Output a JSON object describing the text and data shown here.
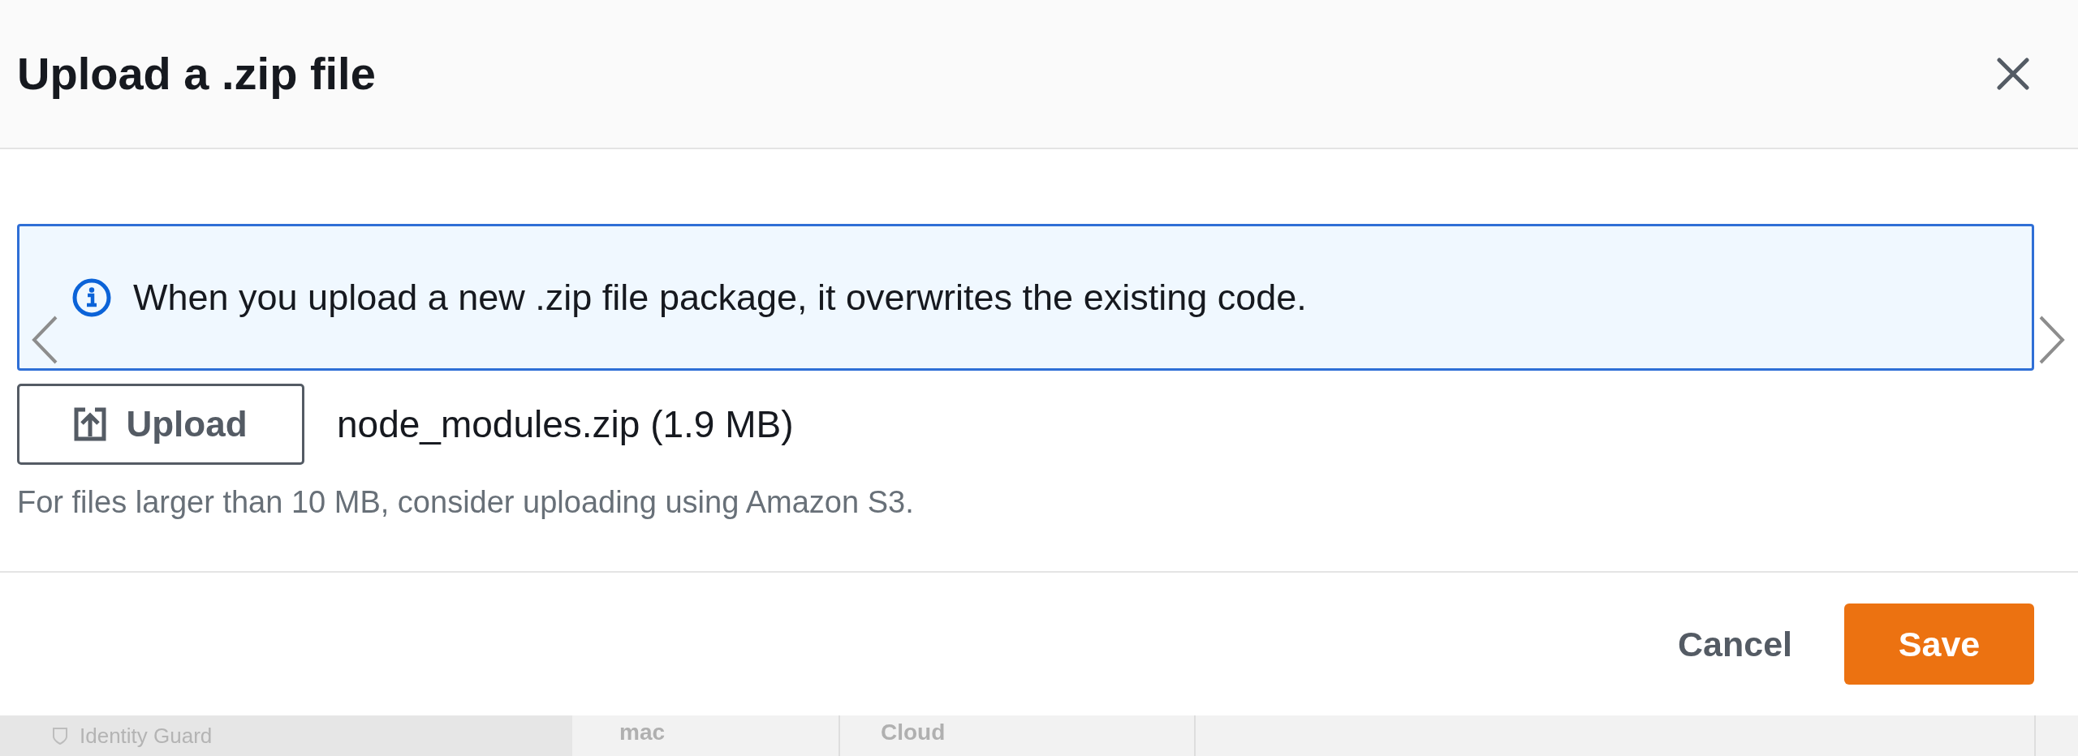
{
  "modal": {
    "title": "Upload a .zip file"
  },
  "alert": {
    "kind": "info",
    "text": "When you upload a new .zip file package, it overwrites the existing code."
  },
  "upload": {
    "button": "Upload",
    "file": "node_modules.zip (1.9 MB)",
    "hint": "For files larger than 10 MB, consider uploading using Amazon S3."
  },
  "footer": {
    "buttons": [
      {
        "label": "Cancel",
        "kind": "link"
      },
      {
        "label": "Save",
        "kind": "primary"
      }
    ]
  },
  "background_page": {
    "sidebar_item": "Identity Guard",
    "cells": [
      "mac",
      "Cloud"
    ]
  }
}
